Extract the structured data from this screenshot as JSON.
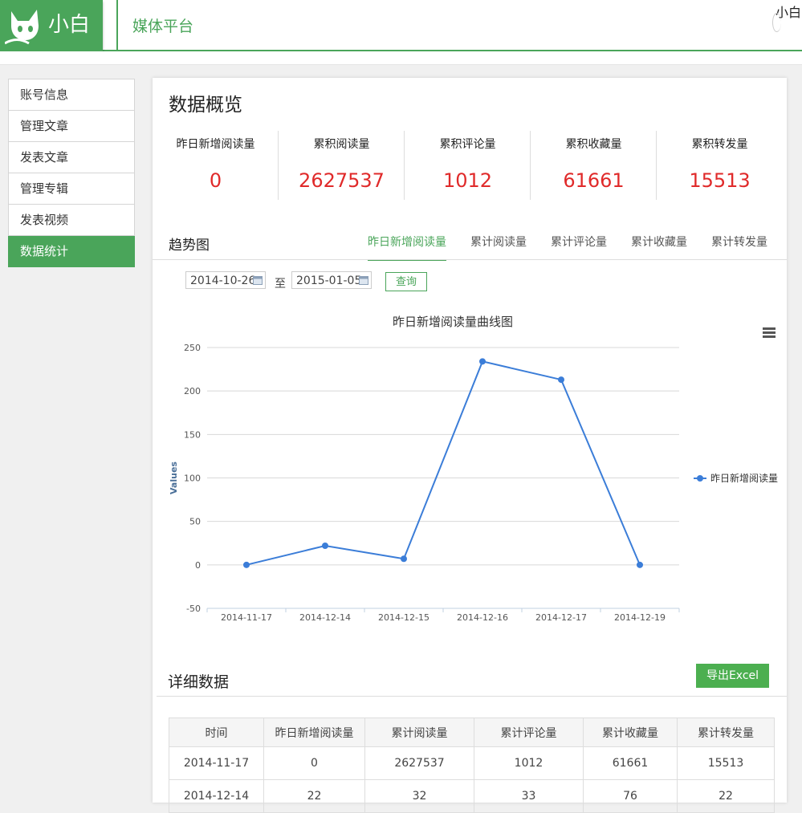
{
  "header": {
    "logo_text": "小白",
    "platform_title": "媒体平台",
    "user_name": "小白"
  },
  "sidebar": {
    "items": [
      {
        "label": "账号信息",
        "active": false
      },
      {
        "label": "管理文章",
        "active": false
      },
      {
        "label": "发表文章",
        "active": false
      },
      {
        "label": "管理专辑",
        "active": false
      },
      {
        "label": "发表视频",
        "active": false
      },
      {
        "label": "数据统计",
        "active": true
      }
    ]
  },
  "overview": {
    "title": "数据概览",
    "stats": [
      {
        "label": "昨日新增阅读量",
        "value": "0"
      },
      {
        "label": "累积阅读量",
        "value": "2627537"
      },
      {
        "label": "累积评论量",
        "value": "1012"
      },
      {
        "label": "累积收藏量",
        "value": "61661"
      },
      {
        "label": "累积转发量",
        "value": "15513"
      }
    ]
  },
  "trend": {
    "title": "趋势图",
    "tabs": [
      {
        "label": "昨日新增阅读量",
        "active": true
      },
      {
        "label": "累计阅读量",
        "active": false
      },
      {
        "label": "累计评论量",
        "active": false
      },
      {
        "label": "累计收藏量",
        "active": false
      },
      {
        "label": "累计转发量",
        "active": false
      }
    ],
    "start_date": "2014-10-26",
    "to_label": "至",
    "end_date": "2015-01-05",
    "query_label": "查询"
  },
  "chart_data": {
    "type": "line",
    "title": "昨日新增阅读量曲线图",
    "xlabel": "",
    "ylabel": "Values",
    "categories": [
      "2014-11-17",
      "2014-12-14",
      "2014-12-15",
      "2014-12-16",
      "2014-12-17",
      "2014-12-19"
    ],
    "series": [
      {
        "name": "昨日新增阅读量",
        "values": [
          0,
          22,
          7,
          234,
          213,
          0
        ],
        "color": "#3b7dd8"
      }
    ],
    "ylim": [
      -50,
      250
    ],
    "yticks": [
      250,
      200,
      150,
      100,
      50,
      0,
      -50
    ],
    "grid": true,
    "legend": "right"
  },
  "detail": {
    "title": "详细数据",
    "export_label": "导出Excel",
    "columns": [
      "时间",
      "昨日新增阅读量",
      "累计阅读量",
      "累计评论量",
      "累计收藏量",
      "累计转发量"
    ],
    "rows": [
      [
        "2014-11-17",
        "0",
        "2627537",
        "1012",
        "61661",
        "15513"
      ],
      [
        "2014-12-14",
        "22",
        "32",
        "33",
        "76",
        "22"
      ]
    ]
  },
  "colors": {
    "brand": "#4aa55a",
    "stat_value": "#e02a2a",
    "series": "#3b7dd8"
  }
}
